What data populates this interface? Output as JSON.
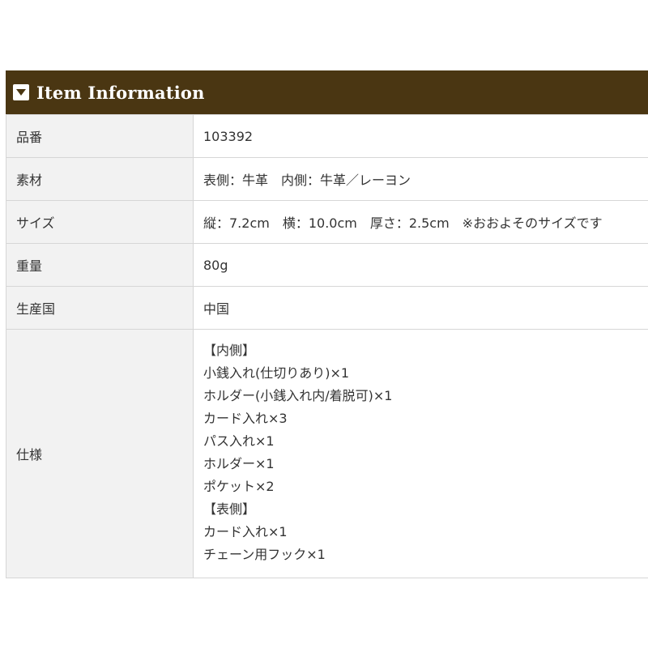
{
  "header": {
    "title": "Item Information",
    "icon": "chevron-down-box-icon"
  },
  "rows": [
    {
      "label": "品番",
      "value": "103392"
    },
    {
      "label": "素材",
      "value": "表側：牛革　内側：牛革／レーヨン"
    },
    {
      "label": "サイズ",
      "value": "縦：7.2cm　横：10.0cm　厚さ：2.5cm　※おおよそのサイズです"
    },
    {
      "label": "重量",
      "value": "80g"
    },
    {
      "label": "生産国",
      "value": "中国"
    }
  ],
  "spec": {
    "label": "仕様",
    "lines": [
      "【内側】",
      "小銭入れ(仕切りあり)×1",
      "ホルダー(小銭入れ内/着脱可)×1",
      "カード入れ×3",
      "パス入れ×1",
      "ホルダー×1",
      "ポケット×2",
      "【表側】",
      "カード入れ×1",
      "チェーン用フック×1"
    ]
  },
  "colors": {
    "header_bg": "#4a3612",
    "label_bg": "#f2f2f2",
    "border": "#d6d6d6"
  }
}
